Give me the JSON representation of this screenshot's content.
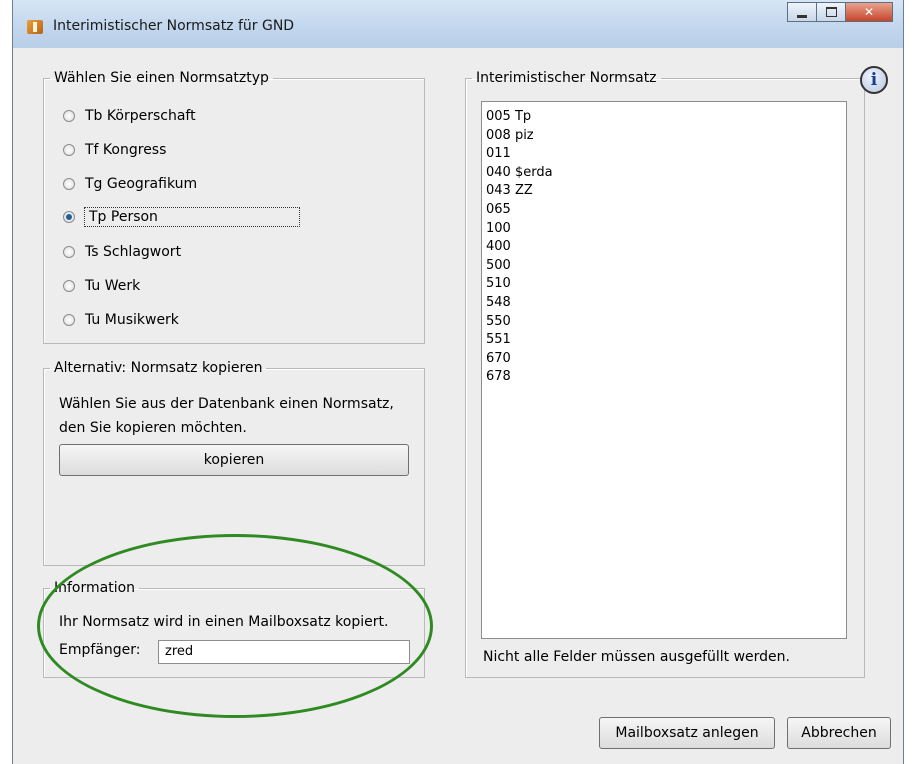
{
  "window": {
    "title": "Interimistischer Normsatz für GND"
  },
  "normsatztyp": {
    "legend": "Wählen Sie einen Normsatztyp",
    "selected": "Tp Person",
    "options": [
      "Tb Körperschaft",
      "Tf Kongress",
      "Tg Geografikum",
      "Tp Person",
      "Ts Schlagwort",
      "Tu Werk",
      "Tu Musikwerk"
    ]
  },
  "kopieren": {
    "legend": "Alternativ: Normsatz kopieren",
    "text_line1": "Wählen Sie aus der Datenbank einen Normsatz,",
    "text_line2": "den Sie kopieren möchten.",
    "button": "kopieren"
  },
  "information": {
    "legend": "Information",
    "text": "Ihr Normsatz wird in einen Mailboxsatz kopiert.",
    "empfaenger_label": "Empfänger:",
    "empfaenger_value": "zred"
  },
  "normsatz": {
    "legend": "Interimistischer Normsatz",
    "lines": [
      "005 Tp",
      "008 piz",
      "011",
      "040 $erda",
      "043 ZZ",
      "065",
      "100",
      "400",
      "500",
      "510",
      "548",
      "550",
      "551",
      "670",
      "678"
    ],
    "note": "Nicht alle Felder müssen ausgefüllt werden."
  },
  "buttons": {
    "create": "Mailboxsatz anlegen",
    "cancel": "Abbrechen"
  },
  "icons": {
    "app": "app-icon",
    "info": "info-icon"
  }
}
